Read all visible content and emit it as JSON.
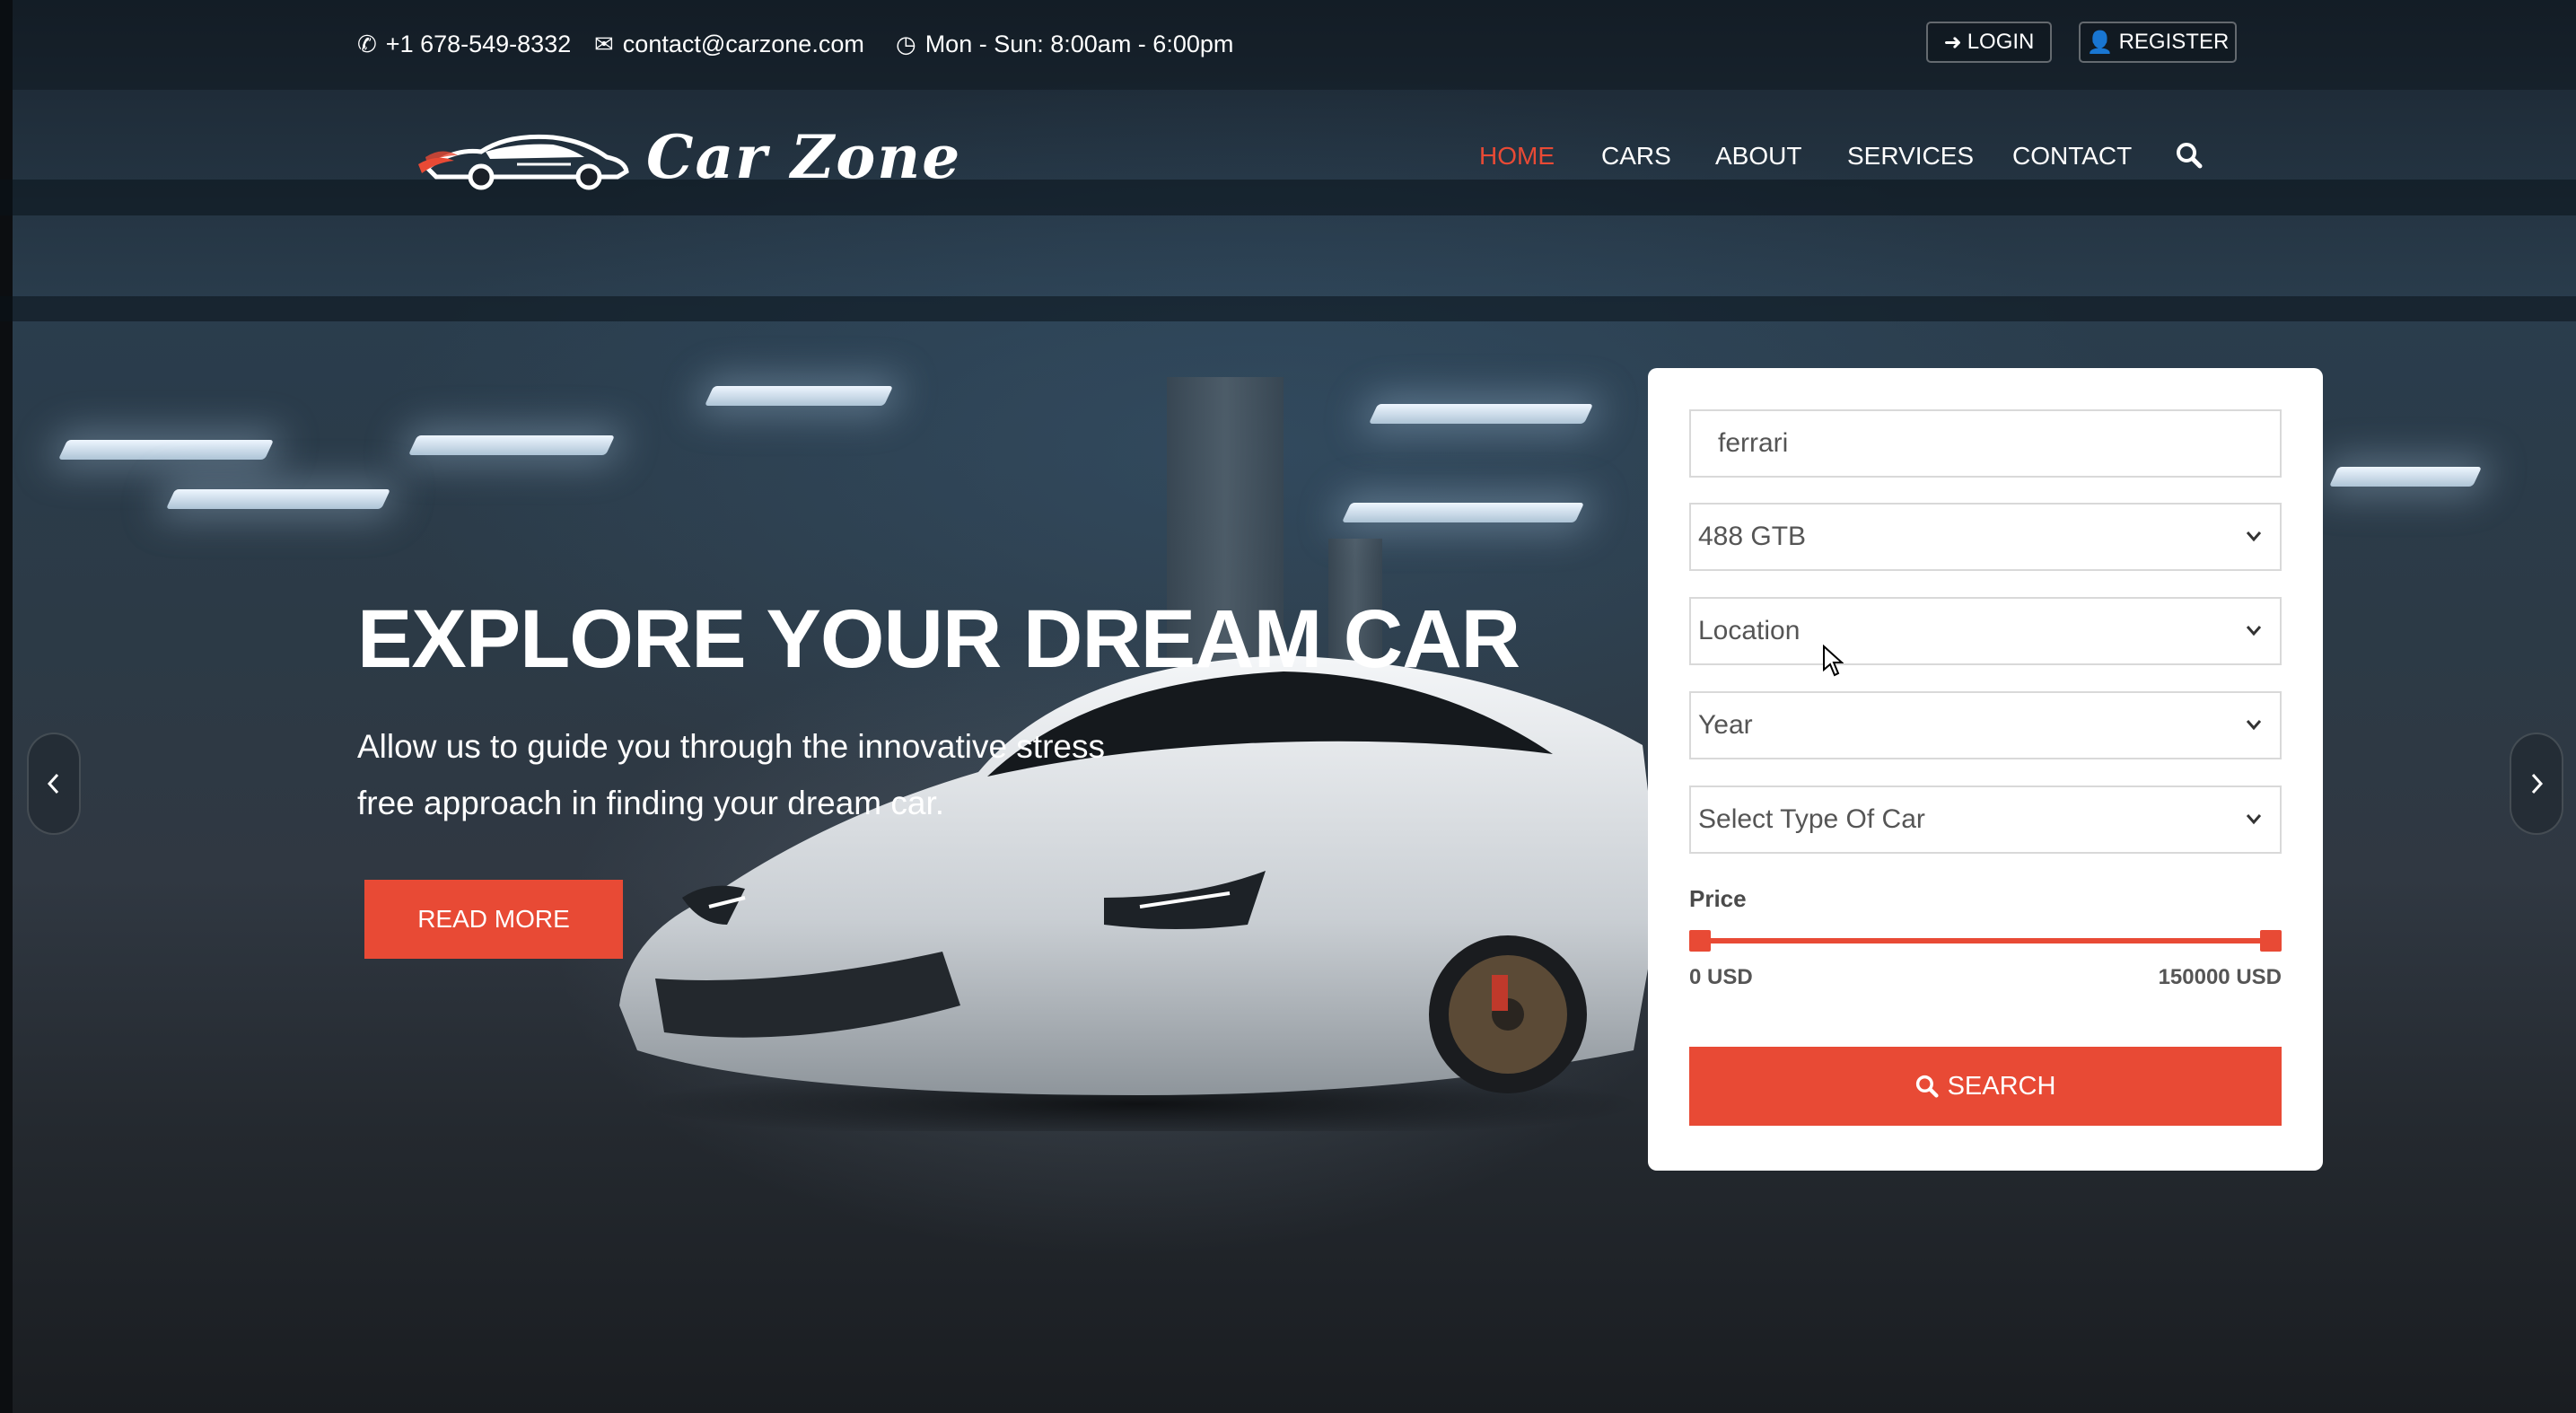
{
  "topbar": {
    "phone": "+1 678-549-8332",
    "email": "contact@carzone.com",
    "hours": "Mon - Sun: 8:00am - 6:00pm",
    "login": "LOGIN",
    "register": "REGISTER",
    "icons": [
      "phone-icon",
      "envelope-icon",
      "clock-icon",
      "sign-in-icon",
      "user-icon"
    ]
  },
  "brand": {
    "name": "Car Zone"
  },
  "nav": {
    "items": [
      "HOME",
      "CARS",
      "ABOUT",
      "SERVICES",
      "CONTACT"
    ],
    "active": "HOME",
    "search_icon": "search-icon"
  },
  "hero": {
    "title": "EXPLORE YOUR DREAM CAR",
    "subtitle_line1": "Allow us to guide you through the innovative stress",
    "subtitle_line2": "free approach in finding your dream car.",
    "cta": "READ MORE"
  },
  "search": {
    "keyword_value": "ferrari",
    "model_value": "488 GTB",
    "location_value": "Location",
    "year_value": "Year",
    "type_value": "Select Type Of Car",
    "price_label": "Price",
    "price_min": "0 USD",
    "price_max": "150000 USD",
    "button": "SEARCH"
  },
  "colors": {
    "accent": "#e84a35",
    "panel": "#ffffff"
  }
}
